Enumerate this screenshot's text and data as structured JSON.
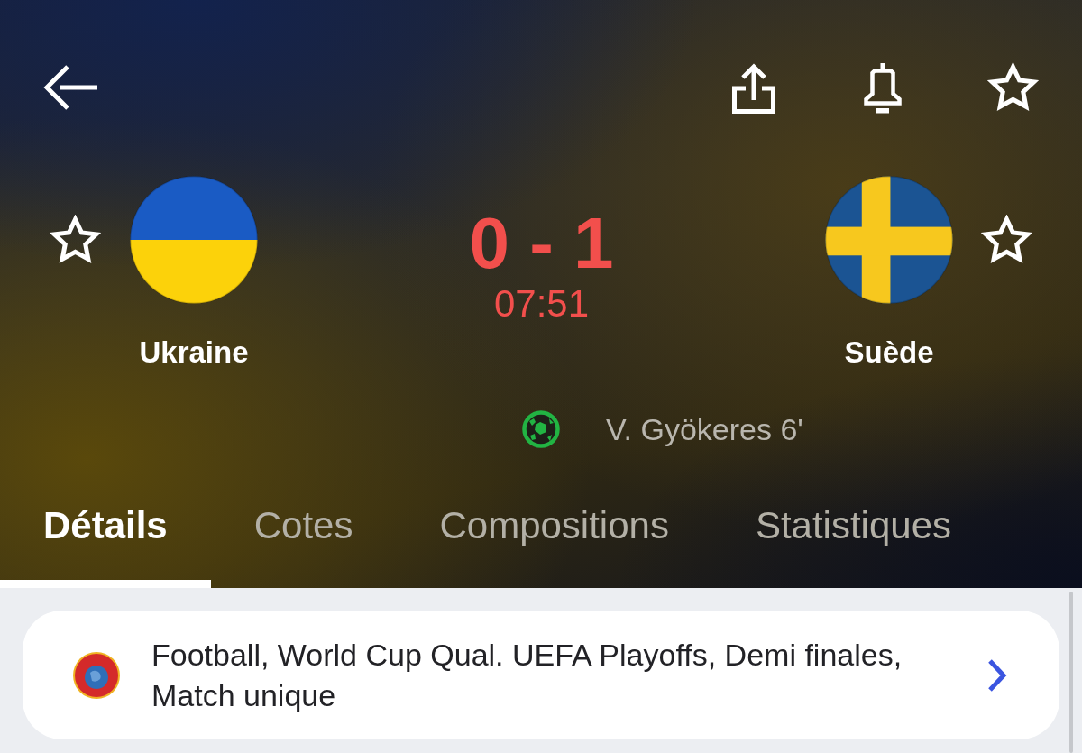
{
  "header": {
    "favorite": false
  },
  "teams": [
    {
      "name": "Ukraine",
      "kind": "ukraine",
      "favorite": false
    },
    {
      "name": "Suède",
      "kind": "sweden",
      "favorite": false,
      "goals": [
        "V. Gyökeres 6'"
      ]
    }
  ],
  "score": "0 - 1",
  "clock": "07:51",
  "tabs": [
    {
      "label": "Détails",
      "selected": true
    },
    {
      "label": "Cotes",
      "selected": false
    },
    {
      "label": "Compositions",
      "selected": false
    },
    {
      "label": "Statistiques",
      "selected": false
    }
  ],
  "competition": {
    "text": "Football, World Cup Qual. UEFA Playoffs, Demi finales, Match unique"
  }
}
